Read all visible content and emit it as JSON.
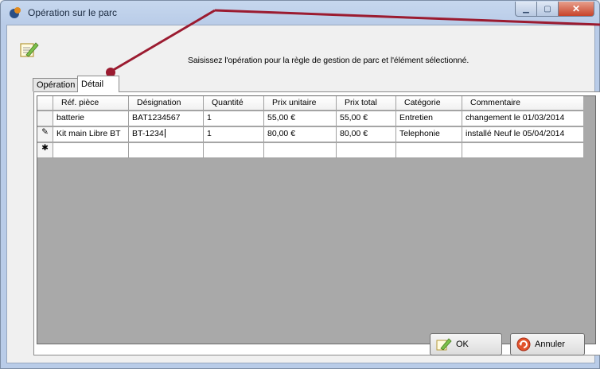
{
  "window": {
    "title": "Opération sur le parc"
  },
  "instruction": "Saisissez l'opération pour la règle de gestion de parc et l'élément sélectionné.",
  "tabs": [
    {
      "label": "Opération",
      "active": false
    },
    {
      "label": "Détail",
      "active": true
    }
  ],
  "grid": {
    "columns": [
      "Réf. pièce",
      "Désignation",
      "Quantité",
      "Prix unitaire",
      "Prix total",
      "Catégorie",
      "Commentaire"
    ],
    "rows": [
      {
        "indicator": "",
        "cells": [
          "batterie",
          "BAT1234567",
          "1",
          "55,00 €",
          "55,00 €",
          "Entretien",
          "changement le 01/03/2014"
        ]
      },
      {
        "indicator": "✎",
        "cells": [
          "Kit main Libre BT",
          "BT-1234",
          "1",
          "80,00 €",
          "80,00 €",
          "Telephonie",
          "installé Neuf le 05/04/2014"
        ]
      },
      {
        "indicator": "✱",
        "cells": [
          "",
          "",
          "",
          "",
          "",
          "",
          ""
        ]
      }
    ]
  },
  "buttons": {
    "ok": "OK",
    "cancel": "Annuler"
  },
  "colors": {
    "annotation": "#9b1b30",
    "grid_background": "#a9a9a9"
  }
}
